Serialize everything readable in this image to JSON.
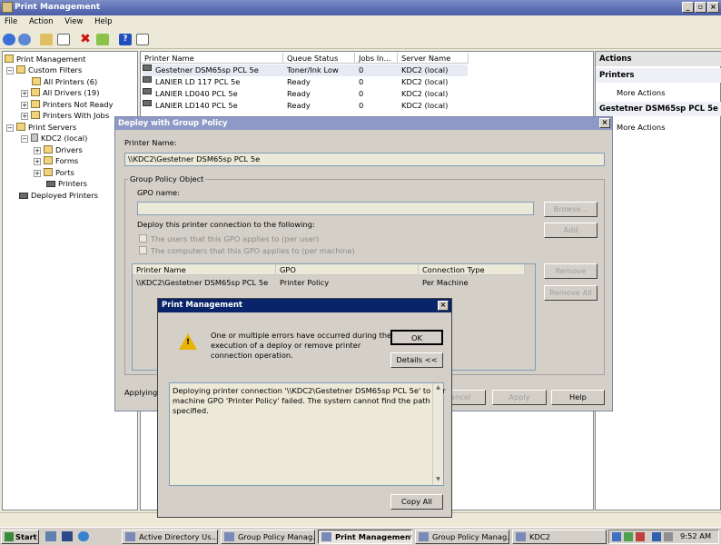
{
  "window": {
    "title": "Print Management"
  },
  "menu": [
    "File",
    "Action",
    "View",
    "Help"
  ],
  "tree": {
    "root": "Print Management",
    "custom_filters": "Custom Filters",
    "all_printers": "All Printers (6)",
    "all_drivers": "All Drivers (19)",
    "printers_not_ready": "Printers Not Ready",
    "printers_with_jobs": "Printers With Jobs",
    "print_servers": "Print Servers",
    "server": "KDC2 (local)",
    "drivers": "Drivers",
    "forms": "Forms",
    "ports": "Ports",
    "printers": "Printers",
    "deployed_printers": "Deployed Printers"
  },
  "list": {
    "columns": [
      "Printer Name",
      "Queue Status",
      "Jobs In...",
      "Server Name"
    ],
    "rows": [
      {
        "name": "Gestetner DSM65sp PCL 5e",
        "status": "Toner/Ink Low",
        "jobs": "0",
        "server": "KDC2 (local)"
      },
      {
        "name": "LANIER LD 117 PCL 5e",
        "status": "Ready",
        "jobs": "0",
        "server": "KDC2 (local)"
      },
      {
        "name": "LANIER LD040 PCL 5e",
        "status": "Ready",
        "jobs": "0",
        "server": "KDC2 (local)"
      },
      {
        "name": "LANIER LD140 PCL 5e",
        "status": "Ready",
        "jobs": "0",
        "server": "KDC2 (local)"
      }
    ]
  },
  "actions": {
    "header": "Actions",
    "section1": "Printers",
    "more1": "More Actions",
    "section2": "Gestetner DSM65sp PCL 5e",
    "more2": "More Actions"
  },
  "deploy": {
    "title": "Deploy with Group Policy",
    "printer_name_label": "Printer Name:",
    "printer_name_value": "\\\\KDC2\\Gestetner DSM65sp PCL 5e",
    "group_label": "Group Policy Object",
    "gpo_name_label": "GPO name:",
    "gpo_name_value": "",
    "browse": "Browse...",
    "add": "Add",
    "deploy_to": "Deploy this printer connection to the following:",
    "per_user": "The users that this GPO applies to (per user)",
    "per_machine": "The computers that this GPO applies to (per machine)",
    "table_columns": [
      "Printer Name",
      "GPO",
      "Connection Type"
    ],
    "table_row": {
      "printer": "\\\\KDC2\\Gestetner DSM65sp PCL 5e",
      "gpo": "Printer Policy",
      "type": "Per Machine"
    },
    "remove": "Remove",
    "remove_all": "Remove All",
    "applying": "Applying G",
    "cancel": "ancel",
    "apply": "Apply",
    "help": "Help"
  },
  "error": {
    "title": "Print Management",
    "message_lines": [
      "One or multiple errors have occurred during the",
      "execution of a deploy or remove printer",
      "connection operation."
    ],
    "ok": "OK",
    "details": "Details <<",
    "detail_lines": [
      "Deploying printer connection '\\\\KDC2\\Gestetner DSM65sp PCL 5e' to per",
      "machine GPO 'Printer Policy' failed. The system cannot find the path",
      "specified."
    ],
    "copy_all": "Copy All"
  },
  "taskbar": {
    "start": "Start",
    "buttons": [
      "Active Directory Us...",
      "Group Policy Manag...",
      "Print Management",
      "Group Policy Manag...",
      "KDC2"
    ],
    "clock": "9:52 AM"
  }
}
